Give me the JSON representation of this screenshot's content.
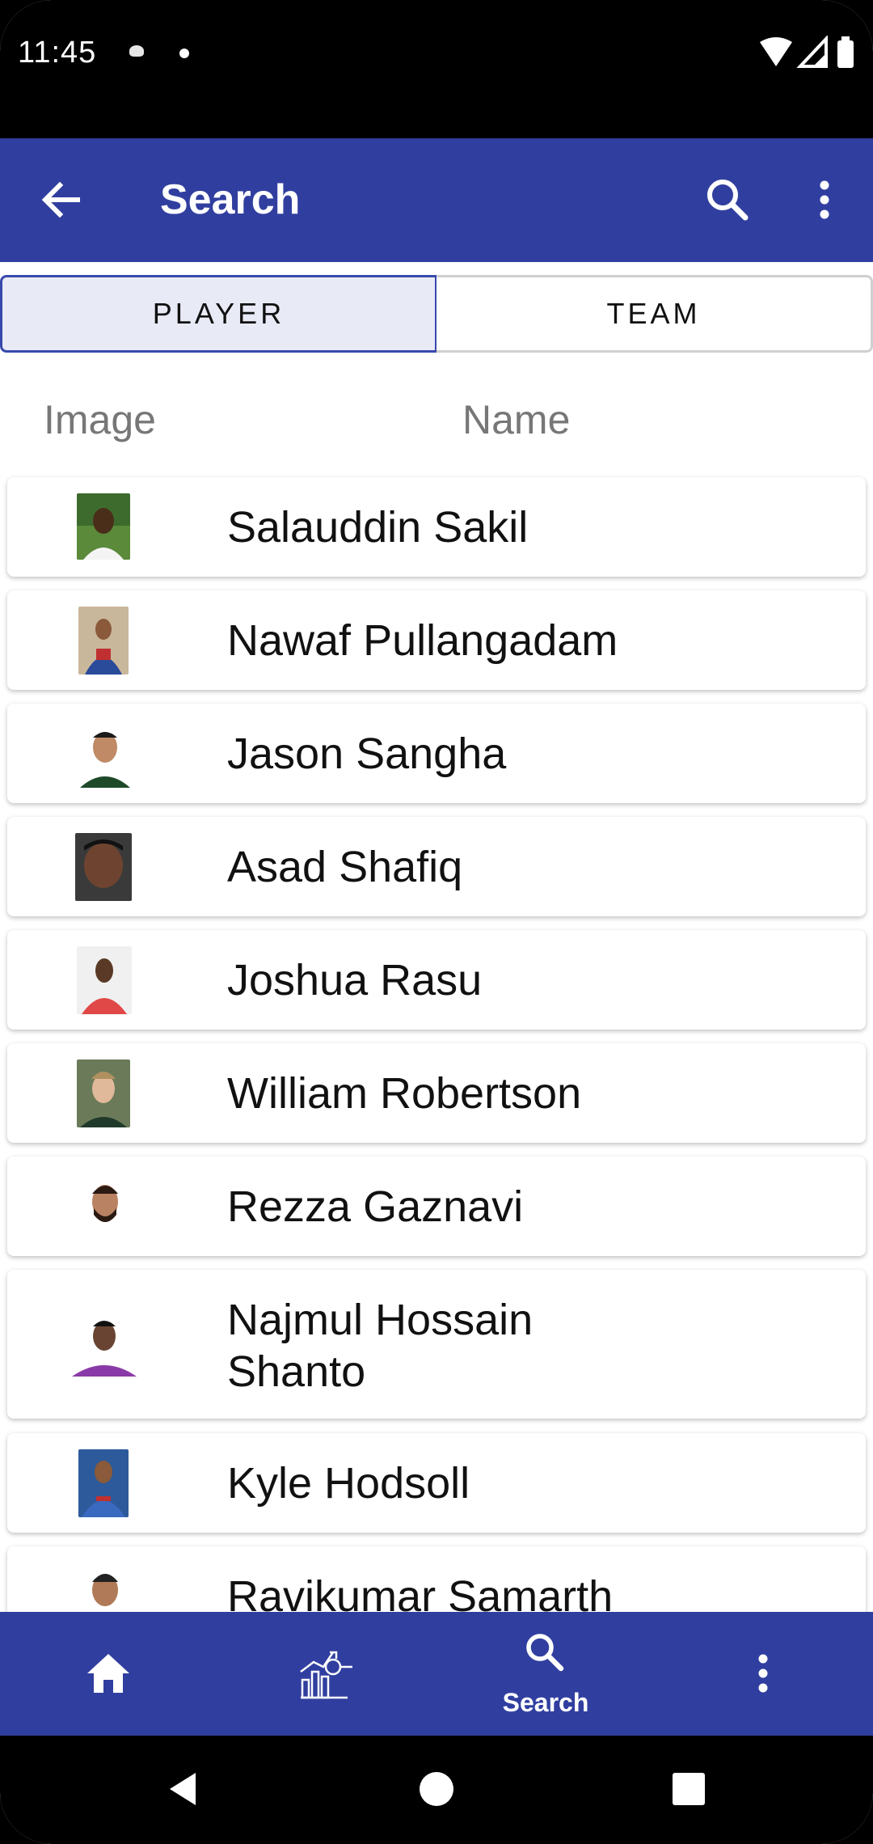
{
  "status": {
    "time": "11:45"
  },
  "app_bar": {
    "title": "Search"
  },
  "toggle": {
    "player": "PLAYER",
    "team": "TEAM"
  },
  "columns": {
    "image": "Image",
    "name": "Name"
  },
  "players": [
    {
      "name": "Salauddin Sakil"
    },
    {
      "name": "Nawaf Pullangadam"
    },
    {
      "name": "Jason Sangha"
    },
    {
      "name": "Asad Shafiq"
    },
    {
      "name": "Joshua Rasu"
    },
    {
      "name": "William Robertson"
    },
    {
      "name": "Rezza Gaznavi"
    },
    {
      "name": "Najmul Hossain",
      "name2": "Shanto"
    },
    {
      "name": "Kyle Hodsoll"
    },
    {
      "name": "Ravikumar Samarth"
    }
  ],
  "bottom_nav": {
    "search_label": "Search"
  },
  "colors": {
    "primary": "#303f9f",
    "selected_tab_bg": "#e8eaf6"
  },
  "icons": [
    "back-arrow-icon",
    "search-icon",
    "more-vert-icon",
    "home-icon",
    "stats-icon",
    "back-triangle-icon",
    "home-circle-icon",
    "recents-square-icon"
  ]
}
